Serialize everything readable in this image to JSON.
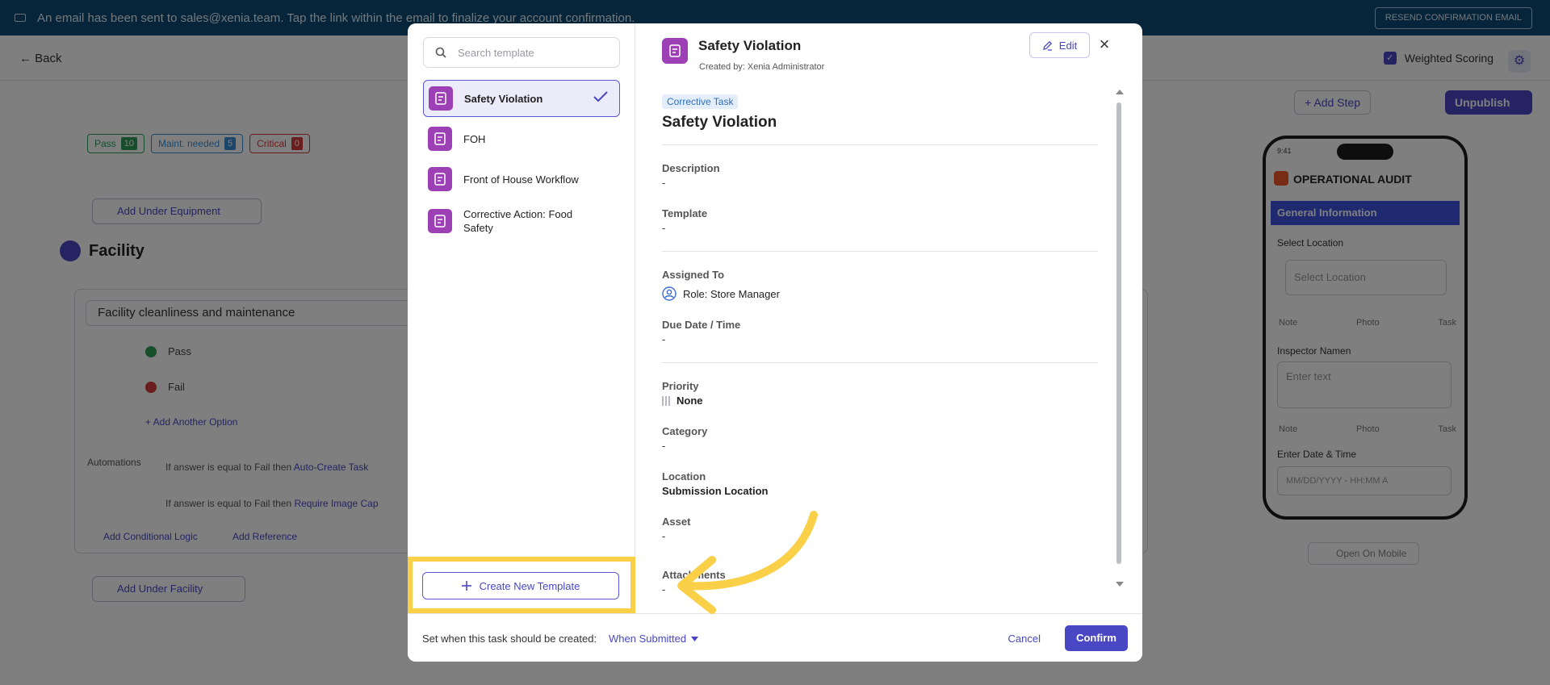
{
  "background": {
    "banner": {
      "message": "An email has been sent to sales@xenia.team. Tap the link within the email to finalize your account confirmation.",
      "resend_label": "RESEND CONFIRMATION EMAIL"
    },
    "back_label": "Back",
    "weighted_scoring_label": "Weighted Scoring",
    "add_step_label": "+ Add Step",
    "unpublish_label": "Unpublish",
    "chips": [
      {
        "label": "Pass",
        "count": "10"
      },
      {
        "label": "Maint. needed",
        "count": "5"
      },
      {
        "label": "Critical",
        "count": "0"
      }
    ],
    "add_under_equipment": "Add Under Equipment",
    "facility_heading": "Facility",
    "question_text": "Facility cleanliness and maintenance",
    "options": [
      "Pass",
      "Fail"
    ],
    "add_another_option": "+ Add Another Option",
    "automations_label": "Automations",
    "automation_rows": [
      {
        "prefix": "If answer is equal to",
        "value": "Fail",
        "then": "then",
        "action": "Auto-Create Task"
      },
      {
        "prefix": "If answer is equal to",
        "value": "Fail",
        "then": "then",
        "action": "Require Image Cap"
      }
    ],
    "add_conditional_logic": "Add Conditional Logic",
    "add_reference": "Add Reference",
    "add_under_facility": "Add Under Facility",
    "phone": {
      "time": "9:41",
      "title": "OPERATIONAL AUDIT",
      "section": "General Information",
      "select_location_label": "Select Location",
      "select_location_placeholder": "Select Location",
      "row_items": [
        "Note",
        "Photo",
        "Task"
      ],
      "inspector_label": "Inspector Namen",
      "inspector_placeholder": "Enter text",
      "date_label": "Enter Date & Time",
      "date_placeholder": "MM/DD/YYYY - HH:MM A"
    },
    "open_on_mobile": "Open On Mobile"
  },
  "modal": {
    "search_placeholder": "Search template",
    "templates": [
      {
        "label": "Safety Violation",
        "selected": true
      },
      {
        "label": "FOH",
        "selected": false
      },
      {
        "label": "Front of House Workflow",
        "selected": false
      },
      {
        "label": "Corrective Action: Food Safety",
        "selected": false
      }
    ],
    "create_new_template": "Create New Template",
    "header": {
      "title": "Safety Violation",
      "created_by": "Created by: Xenia Administrator",
      "edit_label": "Edit"
    },
    "detail": {
      "tag": "Corrective Task",
      "title": "Safety Violation",
      "fields": {
        "description_label": "Description",
        "description_value": "-",
        "template_label": "Template",
        "template_value": "-",
        "assigned_label": "Assigned To",
        "assigned_value": "Role: Store Manager",
        "due_label": "Due Date / Time",
        "due_value": "-",
        "priority_label": "Priority",
        "priority_value": "None",
        "category_label": "Category",
        "category_value": "-",
        "location_label": "Location",
        "location_value": "Submission Location",
        "asset_label": "Asset",
        "asset_value": "-",
        "attachments_label": "Attachments",
        "attachments_value": "-"
      }
    },
    "footer": {
      "label": "Set when this task should be created:",
      "when_value": "When Submitted",
      "cancel_label": "Cancel",
      "confirm_label": "Confirm"
    }
  },
  "colors": {
    "accent": "#4a47c4",
    "template_icon": "#9d40b5",
    "highlight": "#f9d047",
    "banner": "#0d4a75"
  }
}
